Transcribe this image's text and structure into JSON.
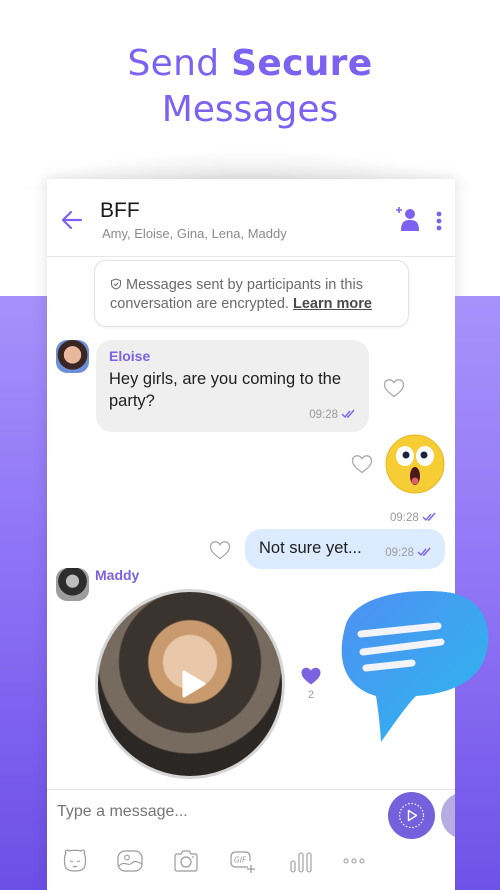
{
  "hero": {
    "line1_prefix": "Send ",
    "line1_bold": "Secure",
    "line2": "Messages"
  },
  "colors": {
    "accent": "#7b62f0",
    "brand_purple": "#7561dc",
    "outgoing_bubble": "#dcebff",
    "incoming_bubble": "#efefef",
    "background_purple": "#8a6ff5"
  },
  "header": {
    "title": "BFF",
    "participants": "Amy, Eloise, Gina, Lena, Maddy",
    "back_icon": "arrow-left-icon",
    "add_member_icon": "add-participant-icon",
    "more_icon": "more-vertical-icon"
  },
  "encryption_notice": {
    "icon": "shield-icon",
    "text": "Messages sent by participants in this conversation are encrypted.",
    "link": "Learn more"
  },
  "messages": [
    {
      "type": "text",
      "direction": "incoming",
      "sender": "Eloise",
      "text": "Hey girls, are you coming to the party?",
      "time": "09:28",
      "status": "read",
      "liked": false
    },
    {
      "type": "sticker",
      "direction": "outgoing",
      "sticker": "surprised-face",
      "time": "09:28",
      "status": "read",
      "liked": false
    },
    {
      "type": "text",
      "direction": "outgoing",
      "text": "Not sure yet...",
      "time": "09:28",
      "status": "read",
      "liked": false
    },
    {
      "type": "video",
      "direction": "incoming",
      "sender": "Maddy",
      "liked": true,
      "like_count": "2"
    }
  ],
  "composer": {
    "placeholder": "Type a message...",
    "tools": [
      "sticker-icon",
      "gallery-icon",
      "camera-icon",
      "gif-icon",
      "voice-icon",
      "more-horizontal-icon"
    ],
    "send_button_icon": "video-message-icon"
  }
}
